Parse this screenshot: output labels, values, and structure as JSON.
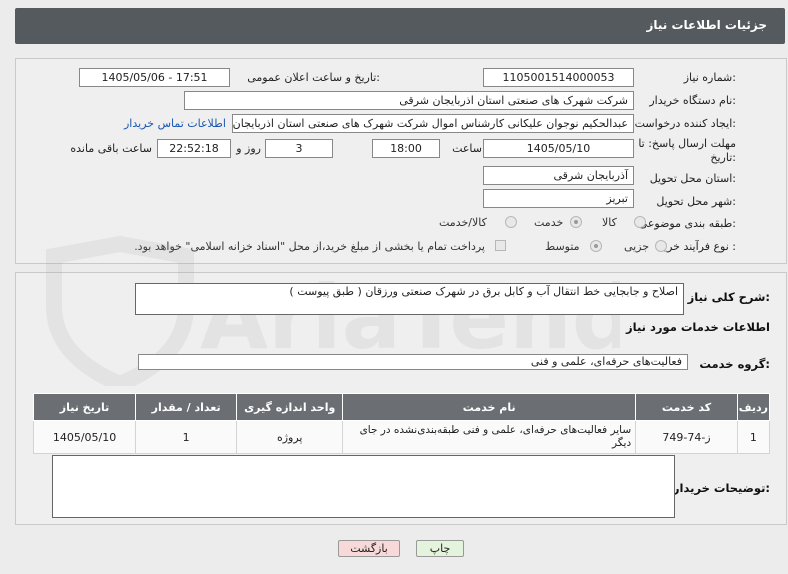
{
  "header": {
    "title": "جزئیات اطلاعات نیاز"
  },
  "form": {
    "need_number": {
      "label": "شماره نیاز:",
      "value": "1105001514000053"
    },
    "announce_datetime": {
      "label": "تاریخ و ساعت اعلان عمومی:",
      "value": "1405/05/06 - 17:51"
    },
    "buyer_org": {
      "label": "نام دستگاه خریدار:",
      "value": "شرکت شهرک های صنعتی استان اذربایجان شرقی"
    },
    "requester": {
      "label": "ایجاد کننده درخواست:",
      "value": "عبدالحکیم نوجوان علیکانی کارشناس اموال شرکت شهرک های صنعتی استان اذربایجان شرقی"
    },
    "buyer_contact_link": "اطلاعات تماس خریدار",
    "deadline": {
      "label": "مهلت ارسال پاسخ: تا تاریخ:",
      "date": "1405/05/10",
      "time_label": "ساعت",
      "time": "18:00",
      "days": "3",
      "days_label": "روز و",
      "remaining": "22:52:18",
      "remaining_label": "ساعت باقی مانده"
    },
    "delivery_province": {
      "label": "استان محل تحویل:",
      "value": "آذربایجان شرقی"
    },
    "delivery_city": {
      "label": "شهر محل تحویل:",
      "value": "تبریز"
    },
    "category": {
      "label": "طبقه بندی موضوعی:",
      "options": [
        "کالا",
        "خدمت",
        "کالا/خدمت"
      ],
      "selected": "خدمت"
    },
    "purchase_type": {
      "label": "نوع فرآیند خرید :",
      "options": [
        "جزیی",
        "متوسط"
      ],
      "selected": "متوسط",
      "treasury_note": "پرداخت تمام یا بخشی از مبلغ خرید،از محل \"اسناد خزانه اسلامی\" خواهد بود."
    }
  },
  "description": {
    "label": "شرح کلی نیاز:",
    "value": "اصلاح و جابجایی خط انتقال آب و کابل برق در شهرک صنعتی ورزقان ( طبق پیوست )"
  },
  "services_section": {
    "title": "اطلاعات خدمات مورد نیاز",
    "group_label": "گروه خدمت:",
    "group_value": "فعالیت‌های حرفه‌ای، علمی و فنی",
    "table": {
      "headers": [
        "ردیف",
        "کد خدمت",
        "نام خدمت",
        "واحد اندازه گیری",
        "تعداد / مقدار",
        "تاریخ نیاز"
      ],
      "rows": [
        [
          "1",
          "ز-74-749",
          "سایر فعالیت‌های حرفه‌ای، علمی و فنی طبقه‌بندی‌نشده در جای دیگر",
          "پروژه",
          "1",
          "1405/05/10"
        ]
      ]
    }
  },
  "buyer_notes": {
    "label": "توضیحات خریدار:",
    "value": ""
  },
  "buttons": {
    "print": "چاپ",
    "back": "بازگشت"
  },
  "watermark": {
    "text": "AriaTender.net"
  },
  "colors": {
    "header_bg": "#555a5e",
    "table_header_bg": "#6b6f73",
    "link": "#1a56b0",
    "back_button_bg": "#f7d9d9",
    "print_button_bg": "#e4f4dc"
  }
}
